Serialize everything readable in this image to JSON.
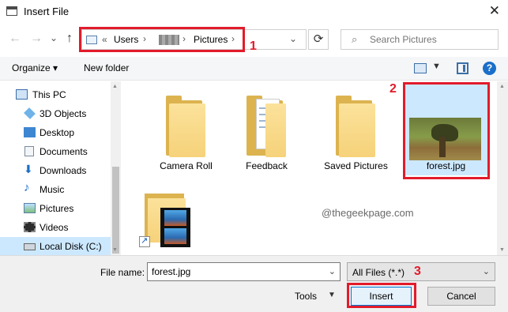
{
  "window": {
    "title": "Insert File",
    "close_symbol": "✕"
  },
  "nav": {
    "back_symbol": "←",
    "forward_symbol": "→",
    "recent_symbol": "⌄",
    "up_symbol": "↑",
    "breadcrumbs": {
      "overflow": "«",
      "users": "Users",
      "pictures": "Pictures",
      "separator": "›"
    },
    "dropdown_symbol": "⌄",
    "refresh_symbol": "⟳",
    "search_placeholder": "Search Pictures",
    "search_icon": "⌕"
  },
  "toolbar": {
    "organize": "Organize ▾",
    "new_folder": "New folder",
    "view_dd": "▼",
    "help": "?"
  },
  "sidebar": {
    "items": [
      {
        "label": "This PC",
        "icon": "pc-icon"
      },
      {
        "label": "3D Objects",
        "icon": "cube-icon"
      },
      {
        "label": "Desktop",
        "icon": "desktop-icon"
      },
      {
        "label": "Documents",
        "icon": "documents-icon"
      },
      {
        "label": "Downloads",
        "icon": "download-icon"
      },
      {
        "label": "Music",
        "icon": "music-icon"
      },
      {
        "label": "Pictures",
        "icon": "pictures-icon"
      },
      {
        "label": "Videos",
        "icon": "videos-icon"
      },
      {
        "label": "Local Disk (C:)",
        "icon": "disk-icon"
      }
    ],
    "scroll_up": "▲",
    "scroll_down": "▼"
  },
  "files": [
    {
      "name": "Camera Roll",
      "type": "folder"
    },
    {
      "name": "Feedback",
      "type": "folder"
    },
    {
      "name": "Saved Pictures",
      "type": "folder"
    },
    {
      "name": "forest.jpg",
      "type": "image",
      "selected": true
    },
    {
      "name": "",
      "type": "video-folder-shortcut"
    }
  ],
  "annotations": {
    "step1": "1",
    "step2": "2",
    "step3": "3",
    "highlight_color": "#e21b2b"
  },
  "watermark": "@thegeekpage.com",
  "bottom": {
    "filename_label": "File name:",
    "filename_value": "forest.jpg",
    "filter_value": "All Files (*.*)",
    "dropdown_symbol": "⌄",
    "tools_label": "Tools",
    "tools_dd": "▼",
    "insert_label": "Insert",
    "cancel_label": "Cancel"
  },
  "colors": {
    "selection": "#cce8ff",
    "accent": "#0078d7",
    "folder": "#f6d27a"
  }
}
